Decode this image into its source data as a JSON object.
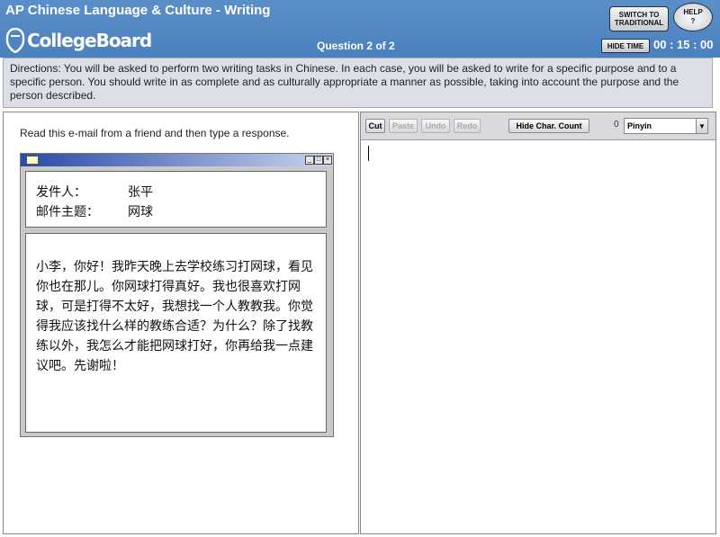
{
  "header": {
    "app_title": "AP Chinese Language & Culture - Writing",
    "logo_text": "CollegeBoard",
    "question_label": "Question 2 of 2",
    "switch_label_line1": "SWITCH TO",
    "switch_label_line2": "TRADITIONAL",
    "help_label": "HELP",
    "help_symbol": "?",
    "hide_time_label": "HIDE TIME",
    "timer": "00 : 15 : 00"
  },
  "directions": {
    "text": "Directions: You will be asked to perform two writing tasks in Chinese. In each case, you will be asked to write for a specific purpose and to a specific person. You should write in as complete and as culturally appropriate a manner as possible, taking into account the purpose and the person described."
  },
  "prompt": {
    "instruction": "Read this e-mail from a friend and then type a response."
  },
  "email": {
    "from_label": "发件人：",
    "from_value": "张平",
    "subject_label": "邮件主题：",
    "subject_value": "网球",
    "body": "小李，你好！我昨天晚上去学校练习打网球，看见你也在那儿。你网球打得真好。我也很喜欢打网球，可是打得不太好，我想找一个人教教我。你觉得我应该找什么样的教练合适？为什么？除了找教练以外，我怎么才能把网球打好，你再给我一点建议吧。先谢啦！"
  },
  "toolbar": {
    "cut": "Cut",
    "paste": "Paste",
    "undo": "Undo",
    "redo": "Redo",
    "char_count": "Hide Char. Count",
    "char_count_value": "0",
    "ime": "Pinyin"
  },
  "colors": {
    "header_blue": "#4a80bd",
    "directions_bg": "#dcdfe8",
    "toolbar_bg": "#d8dade"
  }
}
